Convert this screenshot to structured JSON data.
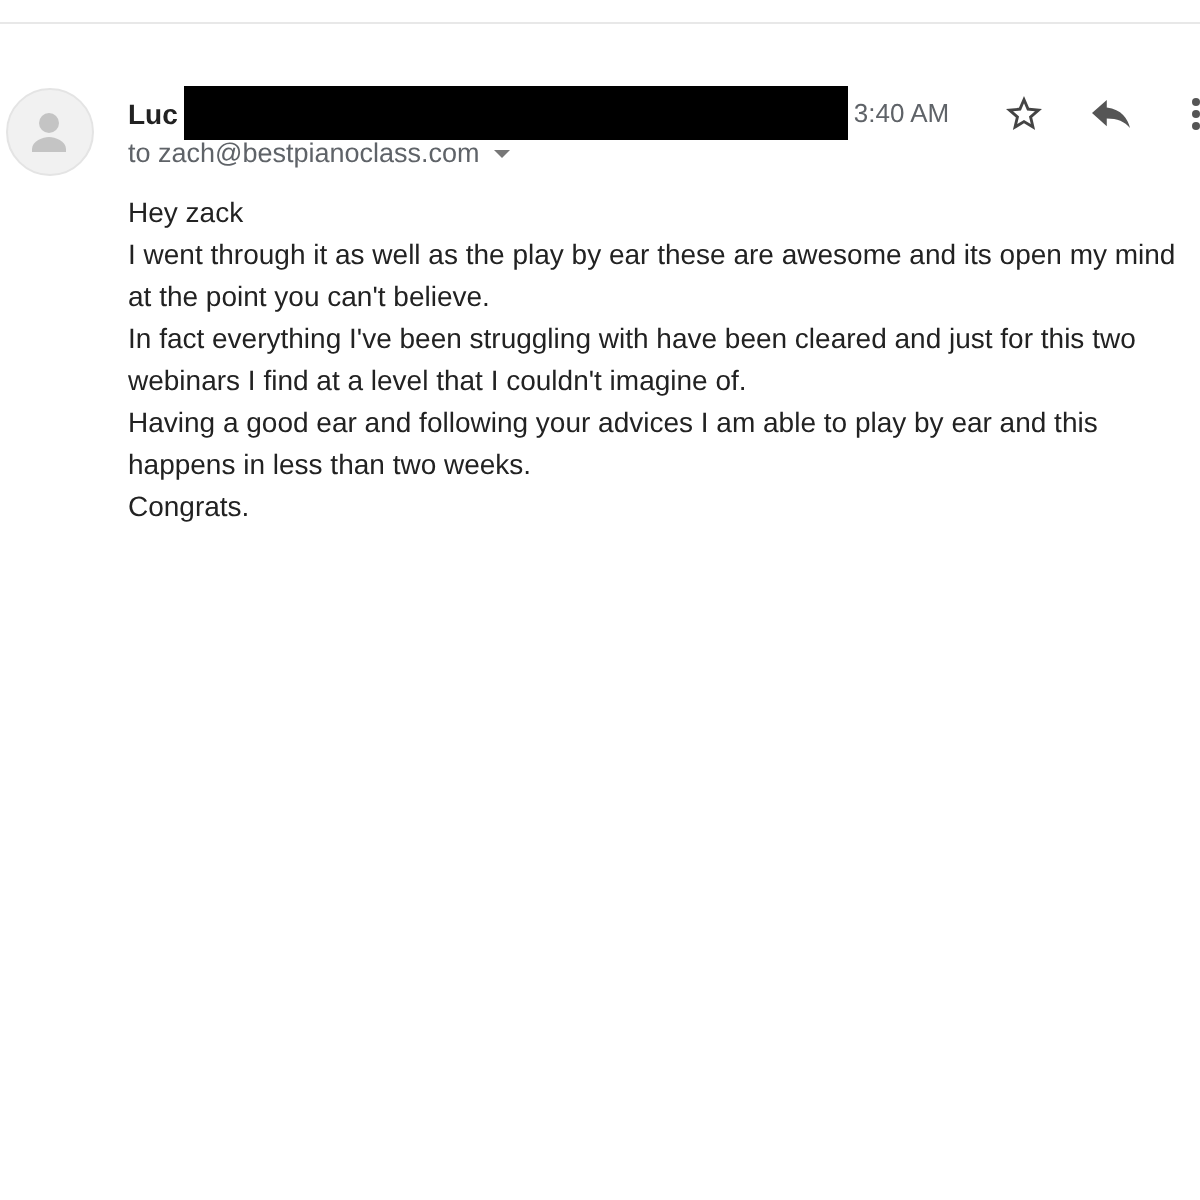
{
  "message": {
    "sender": {
      "name": "Luc",
      "redacted": true
    },
    "time": "3:40 AM",
    "recipient": "to zach@bestpianoclass.com",
    "body": [
      "Hey zack",
      "I went through it as well as the play by ear these are awesome and its open my mind at the point you can't believe.",
      "In fact everything I've been struggling with have been cleared and just for this two webinars I find at a level that I couldn't imagine of.",
      "Having a good ear and following your advices I am able to play by ear and this happens in less than two weeks.",
      "Congrats."
    ]
  }
}
